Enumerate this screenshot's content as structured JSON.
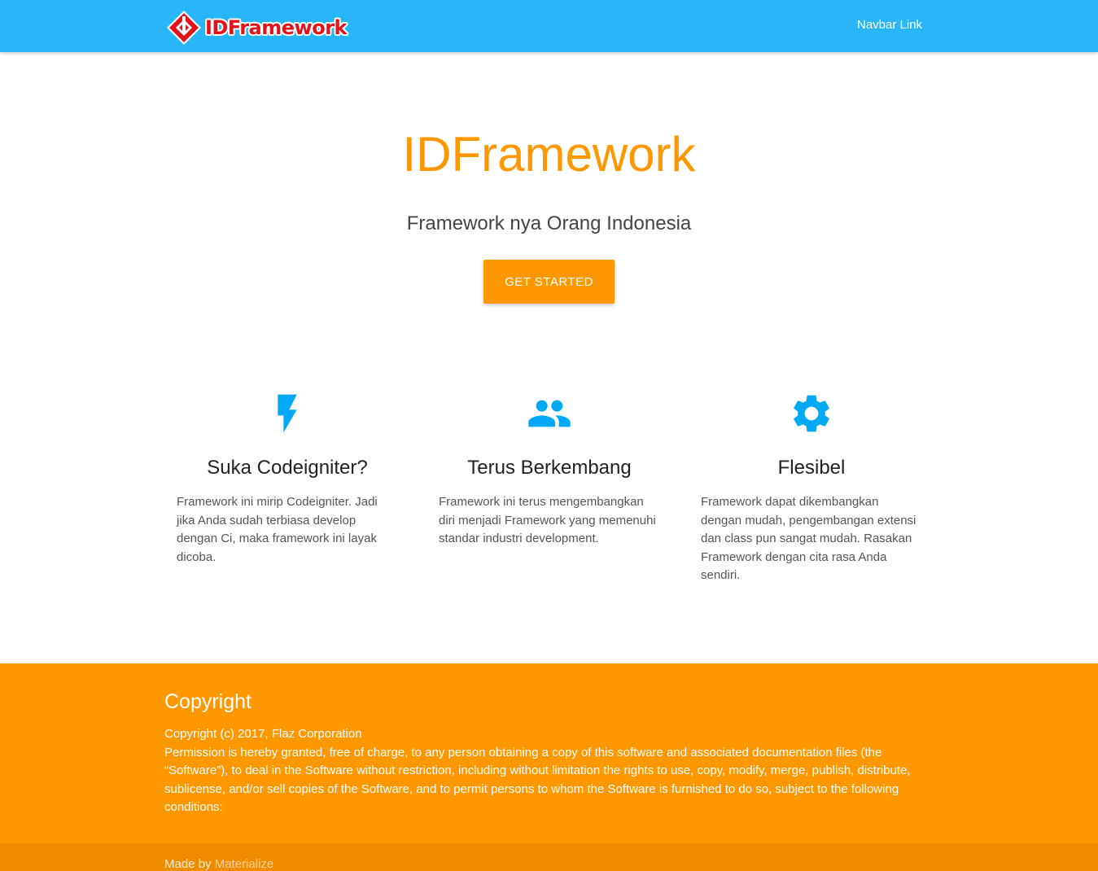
{
  "navbar": {
    "brand": {
      "text": "IDFramework"
    },
    "link": "Navbar Link",
    "bg_color": "#29b6f6"
  },
  "hero": {
    "title": "IDFramework",
    "subtitle": "Framework nya Orang Indonesia",
    "button_label": "GET STARTED"
  },
  "features": [
    {
      "icon": "flash-icon",
      "title": "Suka Codeigniter?",
      "text": "Framework ini mirip Codeigniter. Jadi jika Anda sudah terbiasa develop dengan Ci, maka framework ini layak dicoba."
    },
    {
      "icon": "group-icon",
      "title": "Terus Berkembang",
      "text": "Framework ini terus mengembangkan diri menjadi Framework yang memenuhi standar industri development."
    },
    {
      "icon": "settings-gear-icon",
      "title": "Flesibel",
      "text": "Framework dapat dikembangkan dengan mudah, pengembangan extensi dan class pun sangat mudah. Rasakan Framework dengan cita rasa Anda sendiri."
    }
  ],
  "footer": {
    "heading": "Copyright",
    "copyright_line": "Copyright (c) 2017, Flaz Corporation",
    "license_text": "Permission is hereby granted, free of charge, to any person obtaining a copy of this software and associated documentation files (the “Software”), to deal in the Software without restriction, including without limitation the rights to use, copy, modify, merge, publish, distribute, sublicense, and/or sell copies of the Software, and to permit persons to whom the Software is furnished to do so, subject to the following conditions:",
    "made_by_prefix": "Made by",
    "made_by_link": "Materialize"
  },
  "colors": {
    "primary": "#29b6f6",
    "accent": "#ff9800",
    "icon_blue": "#03a9f4",
    "logo_red": "#e2131b"
  }
}
